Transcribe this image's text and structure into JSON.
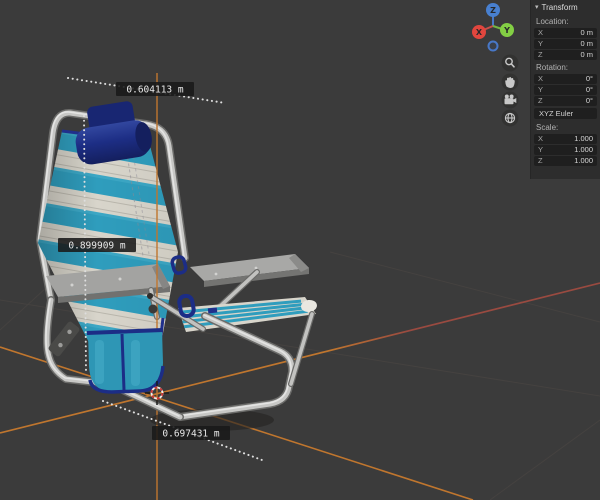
{
  "app": "blender-3d-viewport",
  "viewport": {
    "rulers": [
      {
        "label": "0.604113 m"
      },
      {
        "label": "0.899909 m"
      },
      {
        "label": "0.697431 m"
      }
    ],
    "gizmo": {
      "x": "X",
      "y": "Y",
      "z": "Z"
    },
    "nav_buttons": [
      {
        "icon": "zoom-icon"
      },
      {
        "icon": "pan-hand-icon"
      },
      {
        "icon": "camera-view-icon"
      },
      {
        "icon": "perspective-grid-icon"
      }
    ],
    "colors": {
      "background": "#3b3b3b",
      "axis_orange": "#c0762e",
      "axis_red_muted": "#9a4a40",
      "gizmo_x": "#e1463e",
      "gizmo_y": "#83cf44",
      "gizmo_z": "#4880d0",
      "chair_teal": "#2f9dbd",
      "chair_white": "#d8d5cb",
      "chair_navy": "#1d2e85"
    }
  },
  "panel": {
    "title": "Transform",
    "location": {
      "label": "Location:",
      "rows": [
        {
          "axis": "X",
          "value": "0 m"
        },
        {
          "axis": "Y",
          "value": "0 m"
        },
        {
          "axis": "Z",
          "value": "0 m"
        }
      ]
    },
    "rotation": {
      "label": "Rotation:",
      "rows": [
        {
          "axis": "X",
          "value": "0°"
        },
        {
          "axis": "Y",
          "value": "0°"
        },
        {
          "axis": "Z",
          "value": "0°"
        }
      ]
    },
    "euler_mode": "XYZ Euler",
    "scale": {
      "label": "Scale:",
      "rows": [
        {
          "axis": "X",
          "value": "1.000"
        },
        {
          "axis": "Y",
          "value": "1.000"
        },
        {
          "axis": "Z",
          "value": "1.000"
        }
      ]
    }
  }
}
